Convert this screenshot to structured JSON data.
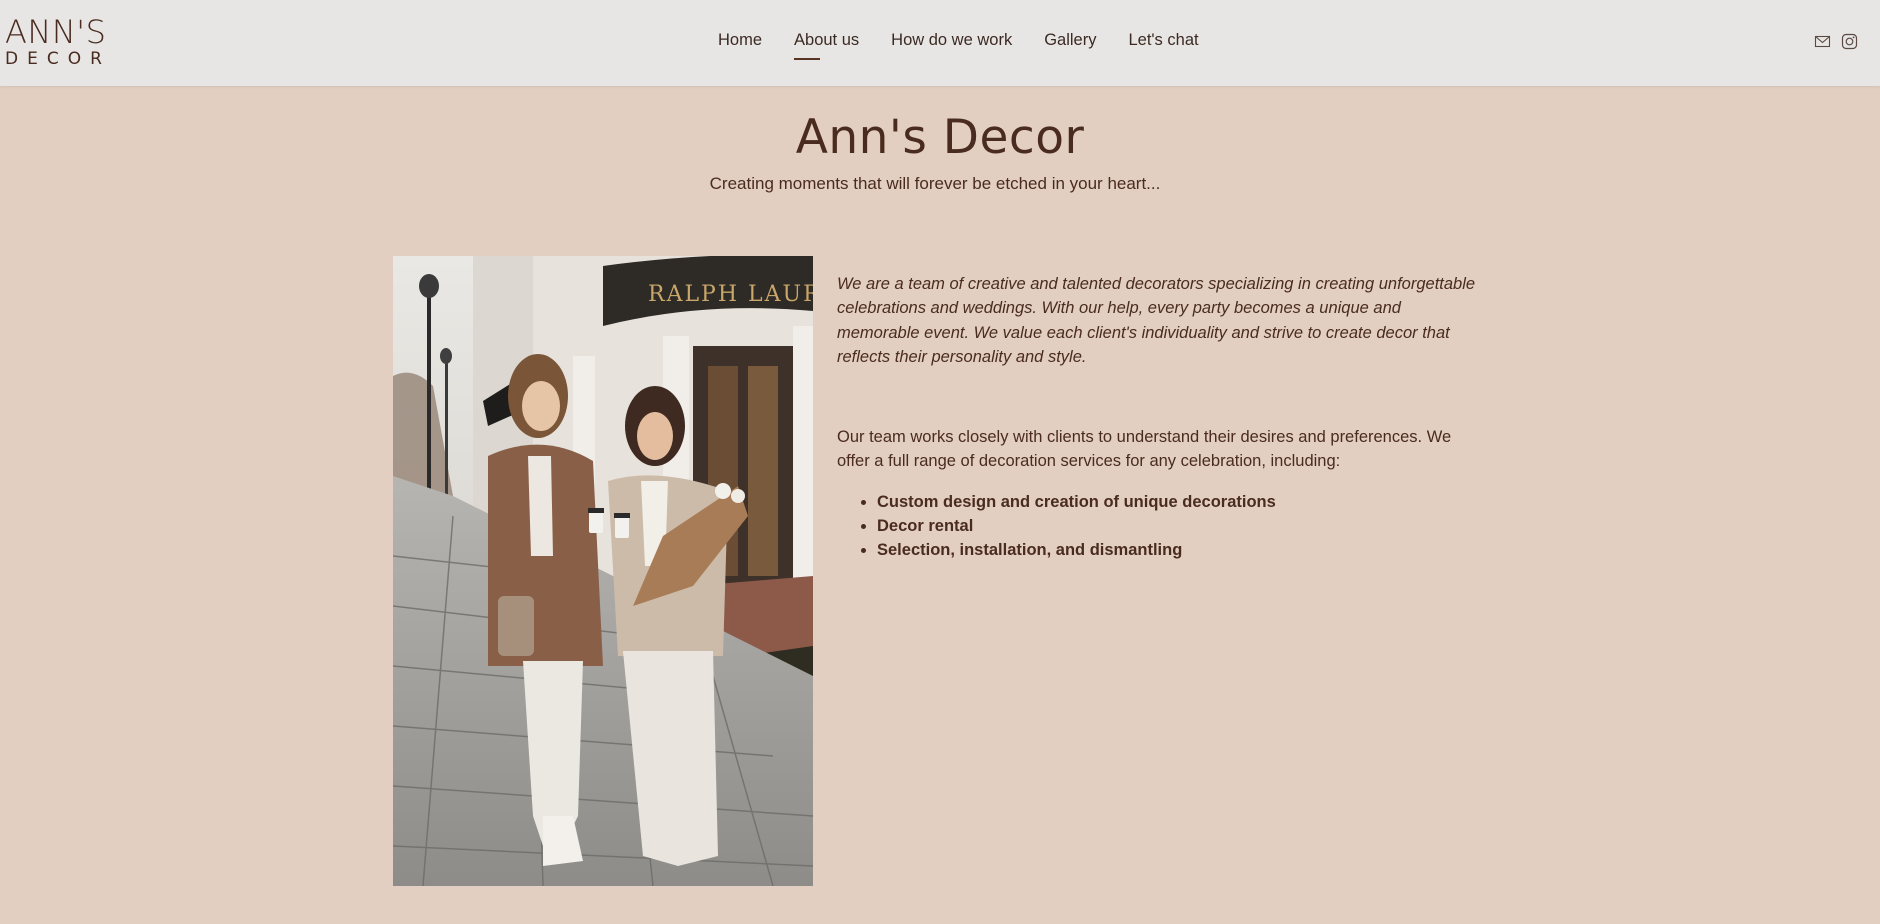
{
  "logo": {
    "line1": "ANN'S",
    "line2": "DECOR"
  },
  "nav": [
    {
      "label": "Home"
    },
    {
      "label": "About us",
      "active": true
    },
    {
      "label": "How do we work"
    },
    {
      "label": "Gallery"
    },
    {
      "label": "Let's chat"
    }
  ],
  "header_icons": [
    "mail-icon",
    "instagram-icon"
  ],
  "main": {
    "title": "Ann's Decor",
    "subtitle": "Creating moments that will forever be etched in your heart...",
    "intro": "We are a team of creative and talented decorators specializing in creating unforgettable celebrations and weddings. With our help, every party becomes a unique and memorable event. We value each client's individuality and strive to create decor that reflects their personality and style.",
    "services_intro": "Our team works closely with clients to understand their desires and preferences. We offer a full range of decoration services for any celebration, including:",
    "services": [
      "Custom design and creation of unique decorations",
      "Decor rental",
      "Selection, installation, and dismantling"
    ],
    "photo": {
      "storefront_sign": "RALPH LAUR"
    }
  },
  "colors": {
    "page_background": "#e2cfc1",
    "header_background": "#e8e6e5",
    "text": "#4a2b1f"
  }
}
